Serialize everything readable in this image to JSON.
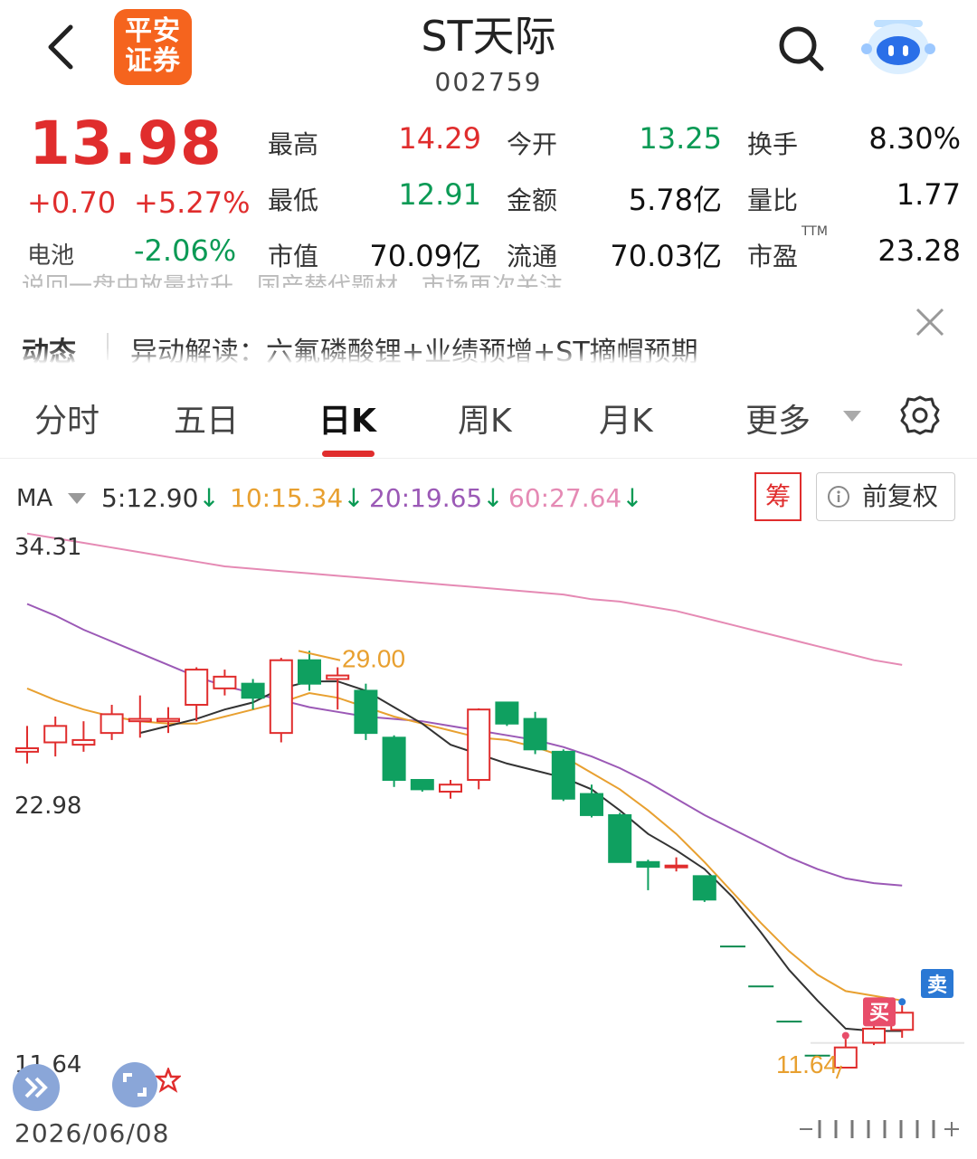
{
  "header": {
    "broker_logo": "平安\n证券",
    "title": "ST天际",
    "code": "002759"
  },
  "quote": {
    "price": "13.98",
    "change": "+0.70",
    "change_pct": "+5.27%",
    "sector_name": "电池",
    "sector_pct": "-2.06%",
    "stats": [
      {
        "label": "最高",
        "value": "14.29",
        "tone": "red"
      },
      {
        "label": "今开",
        "value": "13.25",
        "tone": "green"
      },
      {
        "label": "换手",
        "value": "8.30%",
        "tone": "black"
      },
      {
        "label": "最低",
        "value": "12.91",
        "tone": "green"
      },
      {
        "label": "金额",
        "value": "5.78亿",
        "tone": "black"
      },
      {
        "label": "量比",
        "value": "1.77",
        "tone": "black"
      },
      {
        "label": "市值",
        "value": "70.09亿",
        "tone": "black"
      },
      {
        "label": "流通",
        "value": "70.03亿",
        "tone": "black"
      },
      {
        "label": "市盈",
        "value": "23.28",
        "tone": "black"
      }
    ],
    "pe_suffix": "TTM"
  },
  "news": {
    "faded_line": "说回一盘中放量拉升，国产替代题材，市场再次关注…",
    "tag": "动态",
    "text": "异动解读：六氟磷酸锂+业绩预增+ST摘帽预期"
  },
  "tabs": [
    {
      "label": "分时",
      "active": false
    },
    {
      "label": "五日",
      "active": false
    },
    {
      "label": "日K",
      "active": true
    },
    {
      "label": "周K",
      "active": false
    },
    {
      "label": "月K",
      "active": false
    },
    {
      "label": "更多",
      "active": false
    }
  ],
  "indicator": {
    "label": "MA",
    "ma": [
      {
        "text": "5:12.90",
        "color": "#333333"
      },
      {
        "text": "10:15.34",
        "color": "#e8a030"
      },
      {
        "text": "20:19.65",
        "color": "#9b59b6"
      },
      {
        "text": "60:27.64",
        "color": "#e58ab4"
      }
    ],
    "arrow": "↓",
    "chip_label": "筹",
    "adjust_label": "前复权"
  },
  "chart_data": {
    "type": "candlestick",
    "y_axis_labels": [
      "34.31",
      "22.98",
      "11.64"
    ],
    "ylim": [
      11.64,
      34.31
    ],
    "high_annotation": "29.00",
    "low_annotation": "11.64",
    "sell_marker": "卖",
    "buy_marker": "买",
    "date": "2026/06/08",
    "colors": {
      "up": "#e02d2d",
      "down": "#0fa060",
      "ma5": "#333333",
      "ma10": "#e8a030",
      "ma20": "#9b59b6",
      "ma60": "#e58ab4"
    },
    "candles": [
      [
        25.1,
        25.25,
        26.2,
        24.6
      ],
      [
        25.5,
        26.2,
        26.6,
        24.9
      ],
      [
        25.4,
        25.6,
        26.4,
        25.1
      ],
      [
        25.9,
        26.7,
        27.1,
        25.6
      ],
      [
        26.4,
        26.5,
        27.5,
        25.7
      ],
      [
        26.4,
        26.5,
        27.0,
        25.9
      ],
      [
        27.1,
        28.6,
        28.7,
        26.4
      ],
      [
        27.8,
        28.3,
        28.6,
        27.5
      ],
      [
        28.0,
        27.4,
        28.2,
        26.9
      ],
      [
        25.9,
        29.0,
        29.1,
        25.5
      ],
      [
        29.0,
        28.0,
        29.4,
        27.7
      ],
      [
        28.2,
        28.35,
        28.7,
        26.9
      ],
      [
        27.7,
        25.9,
        28.0,
        25.6
      ],
      [
        25.7,
        23.9,
        25.8,
        23.6
      ],
      [
        23.9,
        23.5,
        23.9,
        23.4
      ],
      [
        23.4,
        23.7,
        23.9,
        23.1
      ],
      [
        23.9,
        26.9,
        26.95,
        23.5
      ],
      [
        27.2,
        26.3,
        27.2,
        26.2
      ],
      [
        26.5,
        25.2,
        26.8,
        25.0
      ],
      [
        25.1,
        23.1,
        25.2,
        23.0
      ],
      [
        23.3,
        22.4,
        23.7,
        22.3
      ],
      [
        22.4,
        20.4,
        22.5,
        20.4
      ],
      [
        20.4,
        20.2,
        20.5,
        19.2
      ],
      [
        20.2,
        20.25,
        20.6,
        20.0
      ],
      [
        19.8,
        18.8,
        19.8,
        18.7
      ],
      [
        16.8,
        16.8,
        16.8,
        16.8
      ],
      [
        15.1,
        15.1,
        15.1,
        15.1
      ],
      [
        13.6,
        13.6,
        13.6,
        13.6
      ],
      [
        12.15,
        12.15,
        12.15,
        12.15
      ],
      [
        11.64,
        12.5,
        12.85,
        11.64
      ],
      [
        12.7,
        13.3,
        13.5,
        12.6
      ],
      [
        13.25,
        13.98,
        14.29,
        12.91
      ]
    ],
    "ma5": [
      null,
      null,
      null,
      null,
      25.9,
      26.2,
      26.5,
      26.9,
      27.2,
      27.8,
      28.1,
      28.1,
      27.7,
      27.0,
      26.3,
      25.4,
      25.0,
      24.6,
      24.3,
      24.0,
      23.5,
      22.6,
      21.6,
      20.9,
      20.1,
      18.9,
      17.4,
      15.8,
      14.5,
      13.3,
      13.2,
      13.2
    ],
    "ma10": [
      27.8,
      27.3,
      26.9,
      26.6,
      26.4,
      26.3,
      26.3,
      26.6,
      26.9,
      27.2,
      27.6,
      27.4,
      27.0,
      26.6,
      26.3,
      26.0,
      25.7,
      25.6,
      25.3,
      24.9,
      24.2,
      23.5,
      22.6,
      21.6,
      20.4,
      19.1,
      17.8,
      16.6,
      15.6,
      14.9,
      14.7,
      14.5
    ],
    "ma20": [
      31.4,
      30.9,
      30.3,
      29.8,
      29.3,
      28.8,
      28.3,
      27.9,
      27.6,
      27.3,
      27.0,
      26.8,
      26.6,
      26.5,
      26.4,
      26.2,
      26.0,
      25.8,
      25.6,
      25.3,
      24.9,
      24.4,
      23.8,
      23.1,
      22.4,
      21.8,
      21.2,
      20.6,
      20.1,
      19.7,
      19.5,
      19.4
    ],
    "ma60": [
      34.4,
      34.2,
      34.0,
      33.8,
      33.6,
      33.4,
      33.2,
      33.0,
      32.9,
      32.8,
      32.7,
      32.6,
      32.5,
      32.4,
      32.3,
      32.2,
      32.1,
      32.0,
      31.9,
      31.8,
      31.6,
      31.5,
      31.3,
      31.1,
      30.8,
      30.5,
      30.2,
      29.9,
      29.6,
      29.3,
      29.0,
      28.8
    ]
  }
}
